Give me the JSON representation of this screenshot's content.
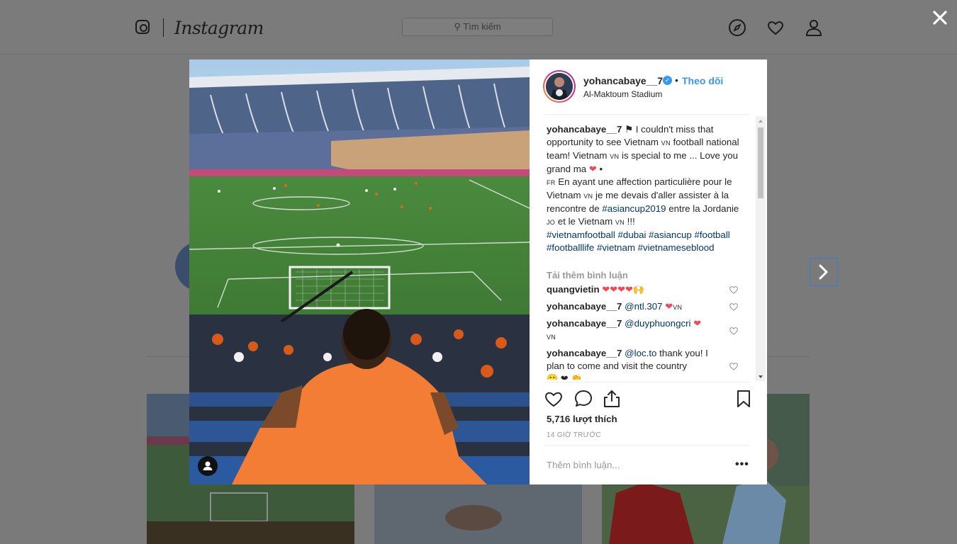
{
  "header": {
    "wordmark": "Instagram",
    "search_placeholder": "Tìm kiếm"
  },
  "post": {
    "username": "yohancabaye__7",
    "verified": true,
    "follow_label": "Theo dõi",
    "location": "Al-Maktoum Stadium",
    "caption_text_1": " I couldn't miss that opportunity to see Vietnam ",
    "flag_vn": "VN",
    "caption_text_2": " football national team! Vietnam ",
    "caption_text_3": " is special to me ... Love you grand ma ",
    "caption_text_4": " •",
    "flag_fr": "FR",
    "caption_text_5": " En ayant une affection particulière pour le Vietnam ",
    "caption_text_6": " je me devais d'aller assister à la rencontre de ",
    "tag_asiancup2019": "#asiancup2019",
    "caption_text_7": " entre la Jordanie ",
    "flag_jo": "JO",
    "caption_text_8": " et le Vietnam ",
    "caption_text_9": " !!!",
    "hashtags_line": "#vietnamfootball #dubai #asiancup #football #footballlife #vietnam #vietnameseblood",
    "load_more": "Tải thêm bình luận",
    "comments": [
      {
        "user": "quangvietin",
        "text": ""
      },
      {
        "user": "yohancabaye__7",
        "mention": "@ntl.307",
        "text": ""
      },
      {
        "user": "yohancabaye__7",
        "mention": "@duyphuongcri",
        "text": ""
      },
      {
        "user": "yohancabaye__7",
        "mention": "@loc.to",
        "text": " thank you! I plan to come and visit the country"
      }
    ],
    "likes": "5,716 lượt thích",
    "time": "14 GIỜ TRƯỚC",
    "add_comment_placeholder": "Thêm bình luận...",
    "more": "•••"
  },
  "colors": {
    "accent": "#3897f0",
    "hashtag": "#003569",
    "heart": "#ed4956"
  }
}
